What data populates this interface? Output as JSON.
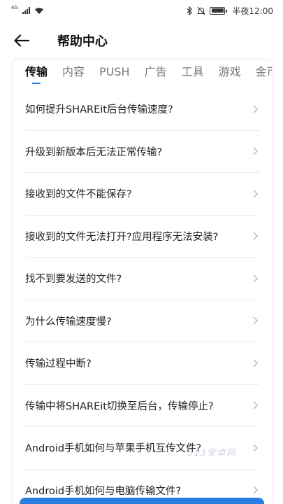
{
  "status": {
    "network": "4G",
    "time": "半夜12:00"
  },
  "header": {
    "title": "帮助中心"
  },
  "tabs": [
    {
      "label": "传输",
      "active": true
    },
    {
      "label": "内容"
    },
    {
      "label": "PUSH"
    },
    {
      "label": "广告"
    },
    {
      "label": "工具"
    },
    {
      "label": "游戏"
    },
    {
      "label": "金币"
    }
  ],
  "questions": [
    "如何提升SHAREit后台传输速度?",
    "升级到新版本后无法正常传输?",
    "接收到的文件不能保存?",
    "接收到的文件无法打开?应用程序无法安装?",
    "找不到要发送的文件?",
    "为什么传输速度慢?",
    "传输过程中断?",
    "传输中将SHAREit切换至后台，传输停止?",
    "Android手机如何与苹果手机互传文件?",
    "Android手机如何与电脑传输文件?"
  ],
  "watermark": "513安卓网",
  "colors": {
    "accent": "#2a7de1"
  }
}
